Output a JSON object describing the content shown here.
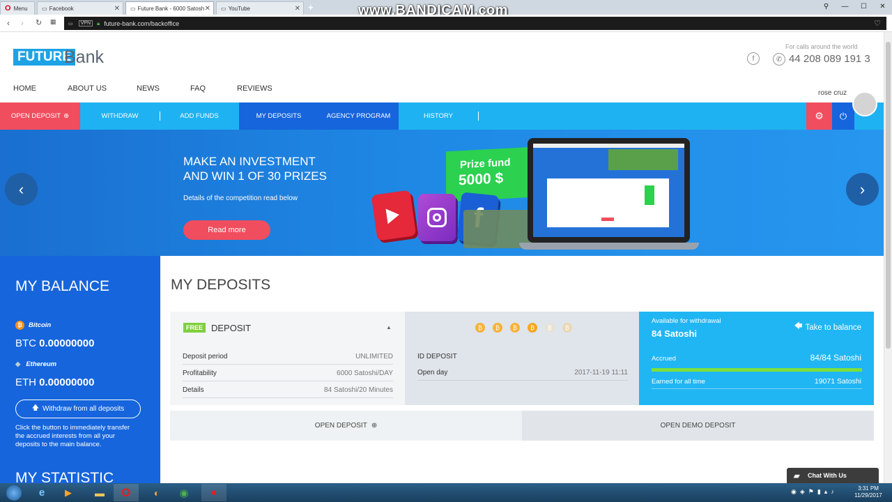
{
  "browser": {
    "tabs": [
      {
        "label": "Menu"
      },
      {
        "label": "Facebook"
      },
      {
        "label": "Future Bank - 6000 Satosh"
      },
      {
        "label": "YouTube"
      }
    ],
    "watermark": "www.BANDICAM.com",
    "vpn_badge": "VPN",
    "url": "future-bank.com/backoffice"
  },
  "header": {
    "logo_future": "FUTURE",
    "logo_bank": "Bank",
    "calls_label": "For calls around the world",
    "phone": "44 208 089 191 3",
    "facebook_glyph": "f",
    "nav": [
      "HOME",
      "ABOUT US",
      "NEWS",
      "FAQ",
      "REVIEWS"
    ],
    "user_name": "rose cruz"
  },
  "mainnav": {
    "open_deposit": "OPEN DEPOSIT",
    "withdraw": "WITHDRAW",
    "add_funds": "ADD FUNDS",
    "my_deposits": "MY DEPOSITS",
    "agency": "AGENCY PROGRAM",
    "history": "HISTORY",
    "accent_colors": {
      "red": "#f04d5e",
      "blue": "#1665dc",
      "light": "#1fb2f2"
    }
  },
  "hero": {
    "title_line1": "MAKE AN INVESTMENT",
    "title_line2": "AND WIN 1 OF 30 PRIZES",
    "subtitle": "Details of the competition read below",
    "button": "Read more",
    "prize_line1": "Prize fund",
    "prize_line2": "5000 $",
    "fb_glyph": "f"
  },
  "balance": {
    "title": "MY BALANCE",
    "btc_name": "Bitcoin",
    "btc_prefix": "BTC",
    "btc_value": "0.00000000",
    "eth_name": "Ethereum",
    "eth_prefix": "ETH",
    "eth_value": "0.00000000",
    "withdraw_button": "Withdraw from all deposits",
    "hint": "Click the button to immediately transfer the accrued interests from all your deposits to the main balance.",
    "statistic_title": "MY STATISTIC"
  },
  "deposits": {
    "title": "MY DEPOSITS",
    "badge": "FREE",
    "deposit_label": "DEPOSIT",
    "rows": [
      {
        "label": "Deposit period",
        "value": "UNLIMITED"
      },
      {
        "label": "Profitability",
        "value": "6000 Satoshi/DAY"
      },
      {
        "label": "Details",
        "value": "84 Satoshi/20 Minutes"
      }
    ],
    "coin_glyph": "₿",
    "id_label": "ID DEPOSIT",
    "open_day_label": "Open day",
    "open_day_value": "2017-11-19 11:11",
    "available_label": "Available for withdrawal",
    "available_value": "84 Satoshi",
    "take_to_balance": "Take to balance",
    "accrued_label": "Accrued",
    "accrued_value": "84/84 Satoshi",
    "accrued_fraction": 1.0,
    "earned_label": "Earned for all time",
    "earned_value": "19071 Satoshi",
    "open_deposit_button": "OPEN DEPOSIT",
    "open_demo_button": "OPEN DEMO DEPOSIT"
  },
  "chat": {
    "label": "Chat With Us"
  },
  "taskbar": {
    "time": "3:31 PM",
    "date": "11/29/2017"
  }
}
